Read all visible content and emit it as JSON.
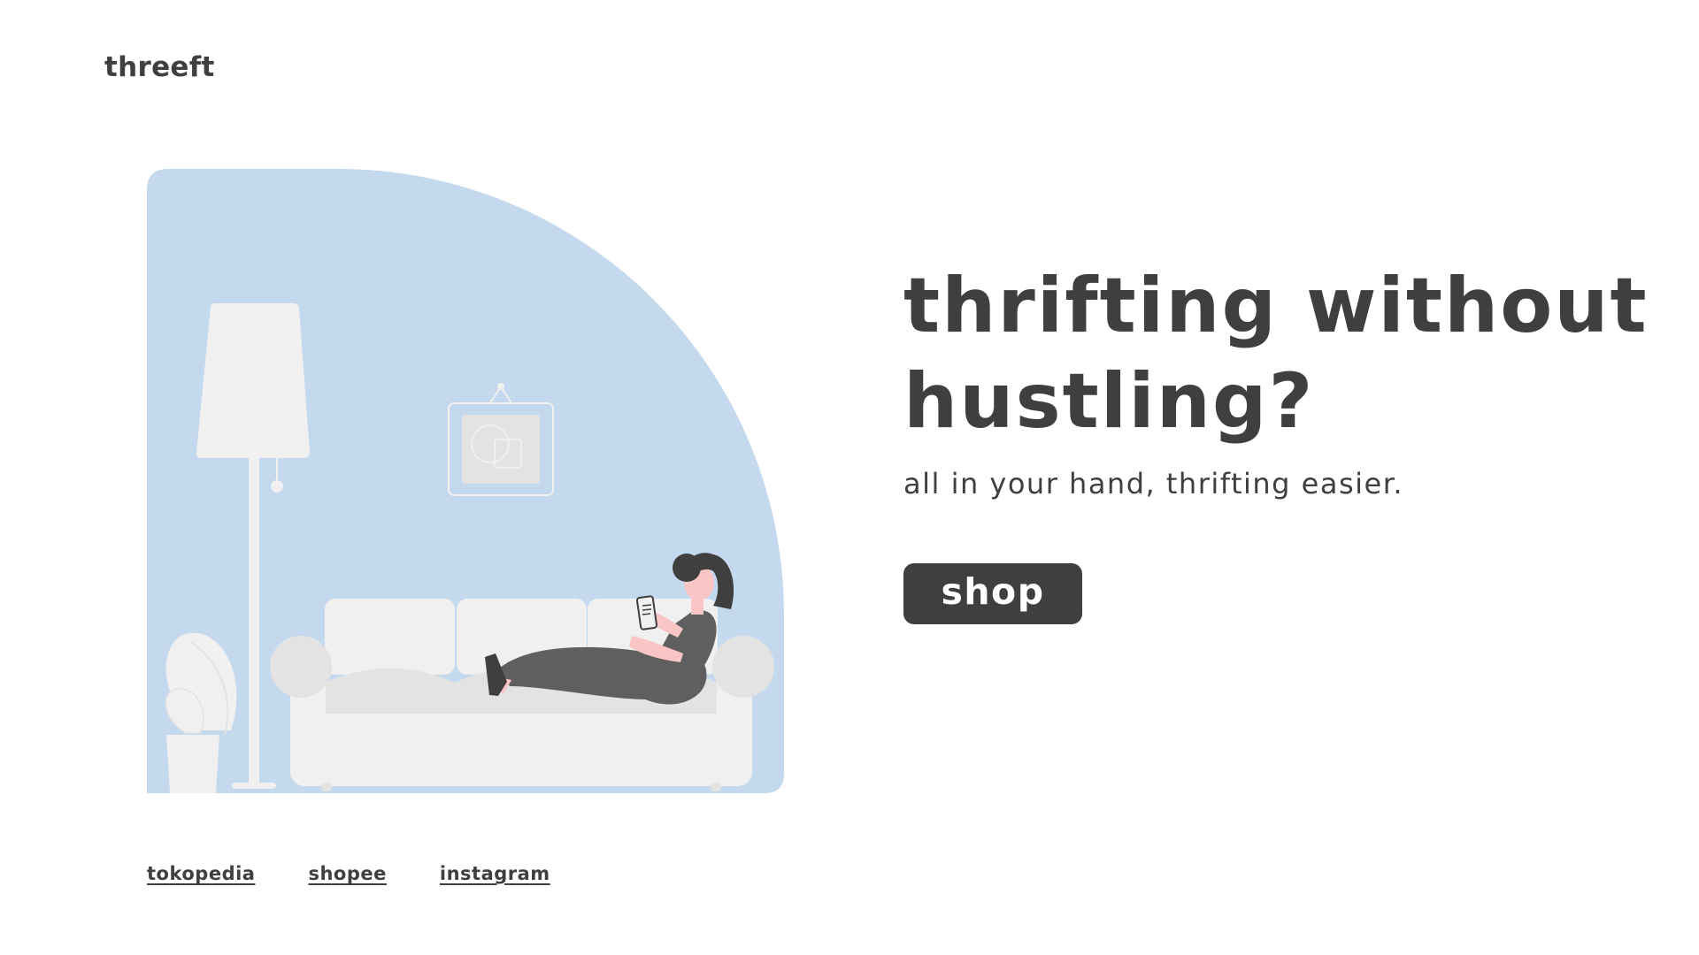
{
  "brand": {
    "logo_text": "threeft"
  },
  "hero": {
    "headline_line1": "thrifting without",
    "headline_line2": "hustling?",
    "tagline": "all in your hand, thrifting easier.",
    "cta_label": "shop"
  },
  "footer": {
    "links": [
      {
        "label": "tokopedia"
      },
      {
        "label": "shopee"
      },
      {
        "label": "instagram"
      }
    ]
  },
  "illustration": {
    "subject": "person lounging on sofa using phone",
    "icons": [
      "floor-lamp-icon",
      "picture-frame-icon",
      "sofa-icon",
      "plant-pot-icon",
      "person-with-phone-icon"
    ]
  },
  "colors": {
    "text_dark": "#3f3f3f",
    "background": "#ffffff",
    "illustration_blue": "#c4d9ed",
    "furniture_light": "#f0f0f0",
    "furniture_shade": "#e3e3e3",
    "skin": "#f9c5c5",
    "clothing": "#5f5f5f",
    "button_bg": "#3f3f3f",
    "button_text": "#ffffff"
  }
}
